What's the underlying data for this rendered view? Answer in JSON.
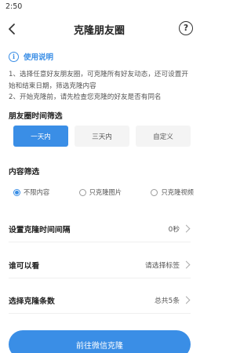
{
  "status_bar": {
    "time": "2:50"
  },
  "nav": {
    "title": "克隆朋友圈",
    "back_icon": "chevron-left-icon",
    "help_label": "?"
  },
  "info": {
    "icon_glyph": "i",
    "title": "使用说明",
    "line1": "1、选择任意好友朋友圈，可克隆所有好友动态，还可设置开始和结束日期，筛选克隆内容",
    "line2": "2、开始克隆前，请先检查您克隆的好友是否有同名"
  },
  "time_filter": {
    "label": "朋友圈时间筛选",
    "options": [
      "一天内",
      "三天内",
      "自定义"
    ],
    "selected_index": 0
  },
  "content_filter": {
    "label": "内容筛选",
    "options": [
      "不限内容",
      "只克隆图片",
      "只克隆视频"
    ],
    "selected_index": 0
  },
  "settings": {
    "interval": {
      "label": "设置克隆时间间隔",
      "value": "0秒"
    },
    "visibility": {
      "label": "谁可以看",
      "value": "请选择标签"
    },
    "count": {
      "label": "选择克隆条数",
      "value": "总共5条"
    }
  },
  "cta": {
    "label": "前往微信克隆"
  },
  "colors": {
    "accent": "#3a8ee6",
    "inactive_bg": "#f4f4f4",
    "text": "#222222"
  }
}
